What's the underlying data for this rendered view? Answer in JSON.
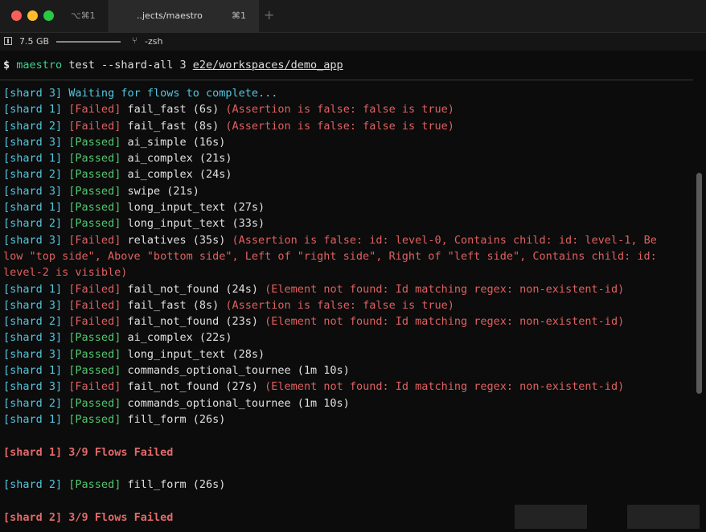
{
  "titlebar": {
    "tab1_shortcut": "⌥⌘1",
    "tab2_title": "..jects/maestro",
    "tab2_shortcut": "⌘1",
    "new_tab": "+"
  },
  "status": {
    "memory": "7.5 GB",
    "shell": "-zsh"
  },
  "prompt": {
    "dollar": "$",
    "command": "maestro",
    "args": " test --shard-all 3 ",
    "path": "e2e/workspaces/demo_app"
  },
  "lines": [
    {
      "shard": "[shard 3]",
      "status": "",
      "name": "Waiting for flows to complete...",
      "msg": "",
      "kind": "waiting"
    },
    {
      "shard": "[shard 1]",
      "status": "[Failed]",
      "name": "fail_fast (6s)",
      "msg": "(Assertion is false: false is true)",
      "kind": "failed"
    },
    {
      "shard": "[shard 2]",
      "status": "[Failed]",
      "name": "fail_fast (8s)",
      "msg": "(Assertion is false: false is true)",
      "kind": "failed"
    },
    {
      "shard": "[shard 3]",
      "status": "[Passed]",
      "name": "ai_simple (16s)",
      "msg": "",
      "kind": "passed"
    },
    {
      "shard": "[shard 1]",
      "status": "[Passed]",
      "name": "ai_complex (21s)",
      "msg": "",
      "kind": "passed"
    },
    {
      "shard": "[shard 2]",
      "status": "[Passed]",
      "name": "ai_complex (24s)",
      "msg": "",
      "kind": "passed"
    },
    {
      "shard": "[shard 3]",
      "status": "[Passed]",
      "name": "swipe (21s)",
      "msg": "",
      "kind": "passed"
    },
    {
      "shard": "[shard 1]",
      "status": "[Passed]",
      "name": "long_input_text (27s)",
      "msg": "",
      "kind": "passed"
    },
    {
      "shard": "[shard 2]",
      "status": "[Passed]",
      "name": "long_input_text (33s)",
      "msg": "",
      "kind": "passed"
    },
    {
      "shard": "[shard 3]",
      "status": "[Failed]",
      "name": "relatives (35s)",
      "msg": "(Assertion is false: id: level-0, Contains child: id: level-1, Be",
      "kind": "failed"
    },
    {
      "shard": "",
      "status": "",
      "name": "",
      "msg": "low \"top side\", Above \"bottom side\", Left of \"right side\", Right of \"left side\", Contains child: id:",
      "kind": "cont"
    },
    {
      "shard": "",
      "status": "",
      "name": "",
      "msg": " level-2 is visible)",
      "kind": "cont"
    },
    {
      "shard": "[shard 1]",
      "status": "[Failed]",
      "name": "fail_not_found (24s)",
      "msg": "(Element not found: Id matching regex: non-existent-id)",
      "kind": "failed"
    },
    {
      "shard": "[shard 3]",
      "status": "[Failed]",
      "name": "fail_fast (8s)",
      "msg": "(Assertion is false: false is true)",
      "kind": "failed"
    },
    {
      "shard": "[shard 2]",
      "status": "[Failed]",
      "name": "fail_not_found (23s)",
      "msg": "(Element not found: Id matching regex: non-existent-id)",
      "kind": "failed"
    },
    {
      "shard": "[shard 3]",
      "status": "[Passed]",
      "name": "ai_complex (22s)",
      "msg": "",
      "kind": "passed"
    },
    {
      "shard": "[shard 3]",
      "status": "[Passed]",
      "name": "long_input_text (28s)",
      "msg": "",
      "kind": "passed"
    },
    {
      "shard": "[shard 1]",
      "status": "[Passed]",
      "name": "commands_optional_tournee (1m 10s)",
      "msg": "",
      "kind": "passed"
    },
    {
      "shard": "[shard 3]",
      "status": "[Failed]",
      "name": "fail_not_found (27s)",
      "msg": "(Element not found: Id matching regex: non-existent-id)",
      "kind": "failed"
    },
    {
      "shard": "[shard 2]",
      "status": "[Passed]",
      "name": "commands_optional_tournee (1m 10s)",
      "msg": "",
      "kind": "passed"
    },
    {
      "shard": "[shard 1]",
      "status": "[Passed]",
      "name": "fill_form (26s)",
      "msg": "",
      "kind": "passed"
    },
    {
      "shard": "",
      "status": "",
      "name": "",
      "msg": "",
      "kind": "blank"
    },
    {
      "shard": "[shard 1]",
      "status": "",
      "name": "3/9 Flows Failed",
      "msg": "",
      "kind": "summary"
    },
    {
      "shard": "",
      "status": "",
      "name": "",
      "msg": "",
      "kind": "blank"
    },
    {
      "shard": "[shard 2]",
      "status": "[Passed]",
      "name": "fill_form (26s)",
      "msg": "",
      "kind": "passed"
    },
    {
      "shard": "",
      "status": "",
      "name": "",
      "msg": "",
      "kind": "blank"
    },
    {
      "shard": "[shard 2]",
      "status": "",
      "name": "3/9 Flows Failed",
      "msg": "",
      "kind": "summary"
    }
  ],
  "colors": {
    "cyan": "#52c6e0",
    "red": "#e06060",
    "green": "#52c86c",
    "command": "#3fcf8e"
  }
}
